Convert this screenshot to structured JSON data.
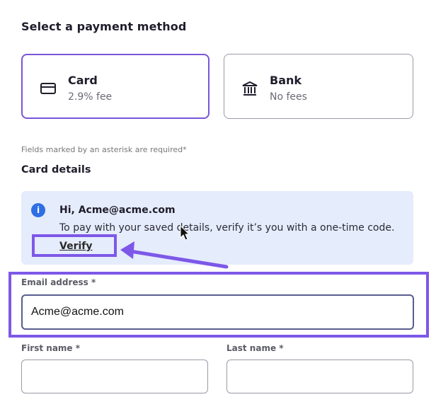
{
  "page": {
    "title": "Select a payment method",
    "required_note": "Fields marked by an asterisk are required*",
    "section_title": "Card details"
  },
  "payment_methods": [
    {
      "name": "Card",
      "fee": "2.9% fee",
      "icon": "card-icon",
      "selected": true
    },
    {
      "name": "Bank",
      "fee": "No fees",
      "icon": "bank-icon",
      "selected": false
    }
  ],
  "info_banner": {
    "icon": "info-icon",
    "icon_glyph": "i",
    "title": "Hi, Acme@acme.com",
    "message": "To pay with your saved details, verify it’s you with a one-time code.",
    "link_label": "Verify"
  },
  "form": {
    "email_label": "Email address *",
    "email_value": "Acme@acme.com",
    "first_name_label": "First name *",
    "last_name_label": "Last name *",
    "first_name_value": "",
    "last_name_value": ""
  },
  "colors": {
    "accent": "#7d58e8",
    "info_background": "#e5ecfb",
    "info_icon": "#2f6fe4"
  }
}
